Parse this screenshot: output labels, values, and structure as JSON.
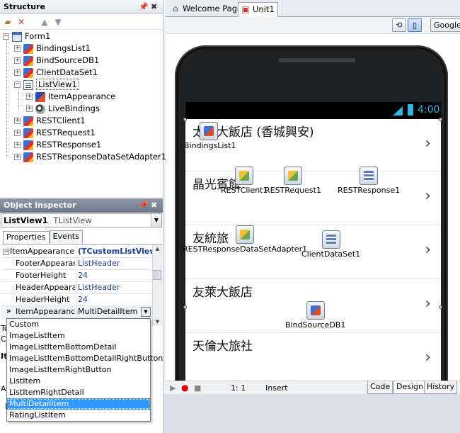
{
  "structure": {
    "title": "Structure",
    "tree": [
      {
        "label": "Form1",
        "icon": "form-icon"
      },
      {
        "label": "BindingsList1",
        "icon": "component-icon"
      },
      {
        "label": "BindSourceDB1",
        "icon": "component-icon"
      },
      {
        "label": "ClientDataSet1",
        "icon": "component-icon"
      },
      {
        "label": "ListView1",
        "icon": "listview-icon"
      },
      {
        "label": "ItemAppearance",
        "icon": "item-appearance-icon"
      },
      {
        "label": "LiveBindings",
        "icon": "livebindings-icon"
      },
      {
        "label": "RESTClient1",
        "icon": "component-icon"
      },
      {
        "label": "RESTRequest1",
        "icon": "component-icon"
      },
      {
        "label": "RESTResponse1",
        "icon": "component-icon"
      },
      {
        "label": "RESTResponseDataSetAdapter1",
        "icon": "component-icon"
      }
    ]
  },
  "inspector": {
    "title": "Object Inspector",
    "object_name": "ListView1",
    "object_type": "TListView",
    "tabs": [
      "Properties",
      "Events"
    ],
    "properties": [
      {
        "name": "ItemAppearance",
        "value": "(TCustomListView.T"
      },
      {
        "name": "FooterAppearan",
        "value": "ListHeader"
      },
      {
        "name": "FooterHeight",
        "value": "24"
      },
      {
        "name": "HeaderAppearar",
        "value": "ListHeader"
      },
      {
        "name": "HeaderHeight",
        "value": "24"
      },
      {
        "name": "ItemAppearance",
        "value": "MultiDetailItem"
      }
    ],
    "behind_text": [
      "To",
      "Cl",
      "It",
      "A",
      "N"
    ]
  },
  "dropdown": {
    "options": [
      "Custom",
      "ImageListItem",
      "ImageListItemBottomDetail",
      "ImageListItemBottomDetailRightButton",
      "ImageListItemRightButton",
      "ListItem",
      "ListItemRightDetail",
      "MultiDetailItem",
      "RatingListItem"
    ],
    "selected": "MultiDetailItem"
  },
  "doc_tabs": [
    "Welcome Page",
    "Unit1"
  ],
  "designer": {
    "style_selector": "Google",
    "status_time": "4:00",
    "list_items": [
      "太子大飯店 (香城興安)",
      "晶光賓館",
      "友統旅",
      "友萊大飯店",
      "天倫大旅社"
    ],
    "components": [
      "BindingsList1",
      "RESTClient1",
      "RESTRequest1",
      "RESTResponse1",
      "RESTResponseDataSetAdapter1",
      "ClientDataSet1",
      "BindSourceDB1"
    ]
  },
  "editor_status": {
    "position": "1:  1",
    "mode": "Insert",
    "view_tabs": [
      "Code",
      "Design",
      "History"
    ]
  },
  "colors": {
    "android_accent": "#33b5e5",
    "selection": "#3399ff"
  }
}
